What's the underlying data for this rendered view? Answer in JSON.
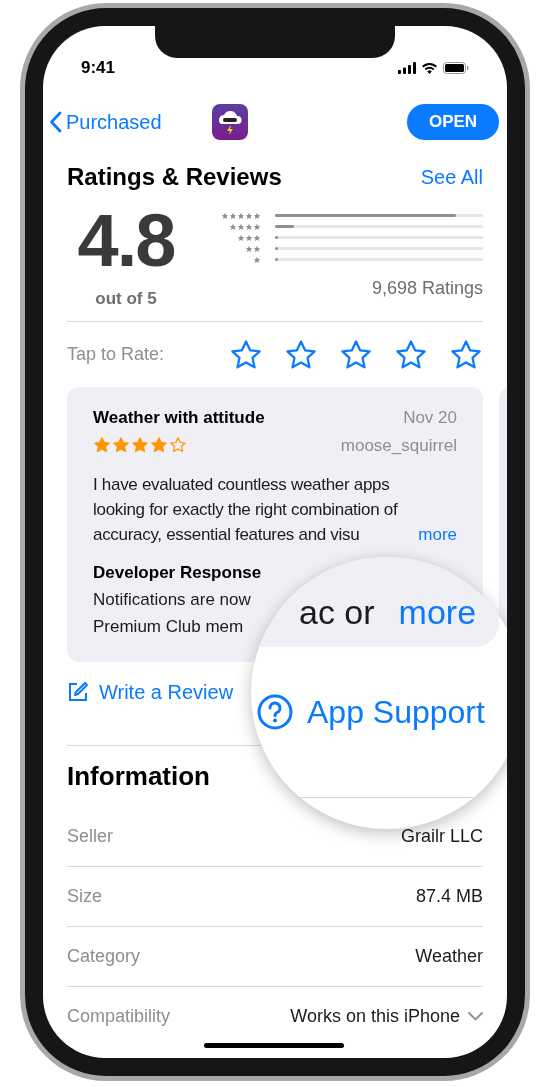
{
  "status_bar": {
    "time": "9:41"
  },
  "nav": {
    "back": "Purchased",
    "button": "OPEN"
  },
  "ratings": {
    "title": "Ratings & Reviews",
    "see_all": "See All",
    "score": "4.8",
    "out_of": "out of 5",
    "count": "9,698 Ratings",
    "histogram": [
      {
        "level": 0.87
      },
      {
        "level": 0.09
      },
      {
        "level": 0.01
      },
      {
        "level": 0.005
      },
      {
        "level": 0.01
      }
    ]
  },
  "tap_to_rate": {
    "label": "Tap to Rate:",
    "stars": 0
  },
  "review": {
    "title": "Weather with attitude",
    "date": "Nov 20",
    "author": "moose_squirrel",
    "stars": 4,
    "body": "I have evaluated countless weather apps looking for exactly the right combination of accuracy, essential features and visu",
    "more": "more",
    "developer_response": {
      "title": "Developer Response",
      "lines": [
        "Notifications are now",
        "Premium Club mem"
      ]
    }
  },
  "write_review": "Write a Review",
  "magnifier": {
    "text": "ac or",
    "more": "more",
    "link": "App Support"
  },
  "information": {
    "title": "Information",
    "rows": [
      {
        "label": "Seller",
        "value": "Grailr LLC"
      },
      {
        "label": "Size",
        "value": "87.4 MB"
      },
      {
        "label": "Category",
        "value": "Weather"
      },
      {
        "label": "Compatibility",
        "value": "Works on this iPhone",
        "expandable": true
      }
    ]
  }
}
